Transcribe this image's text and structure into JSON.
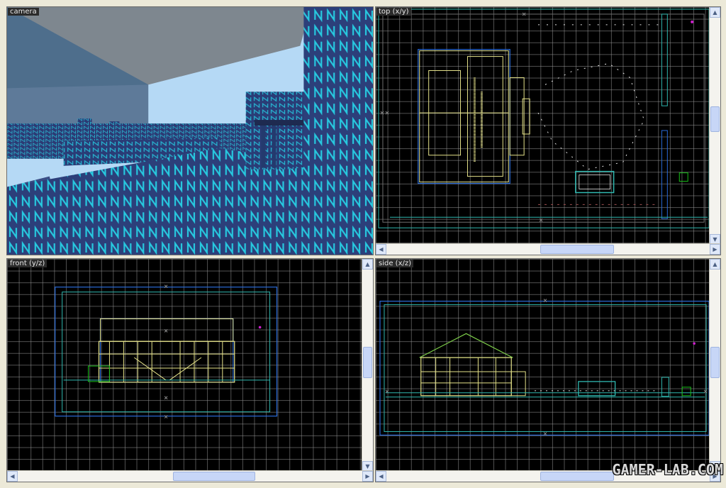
{
  "views": {
    "camera": {
      "label": "camera"
    },
    "top": {
      "label": "top (x/y)"
    },
    "front": {
      "label": "front (y/z)"
    },
    "side": {
      "label": "side (x/z)"
    }
  },
  "scrollbars": {
    "up_arrow": "▲",
    "down_arrow": "▼",
    "left_arrow": "◀",
    "right_arrow": "▶"
  },
  "watermark": "GAMER-LAB.COM",
  "colors": {
    "grid": "#8c8c8c",
    "outer_brush": "#2a6bd9",
    "inner_brush": "#2fb8b0",
    "house": "#e6e38a",
    "roof": "#7fd04a",
    "entity": "#18c018",
    "sky": "#b5d9f5",
    "ceiling": "#808890",
    "wall": "#2f4f8a",
    "texture": "#27c9df"
  },
  "icons": {
    "vertex": "small-square-icon",
    "brush_center": "x-cross-icon"
  }
}
